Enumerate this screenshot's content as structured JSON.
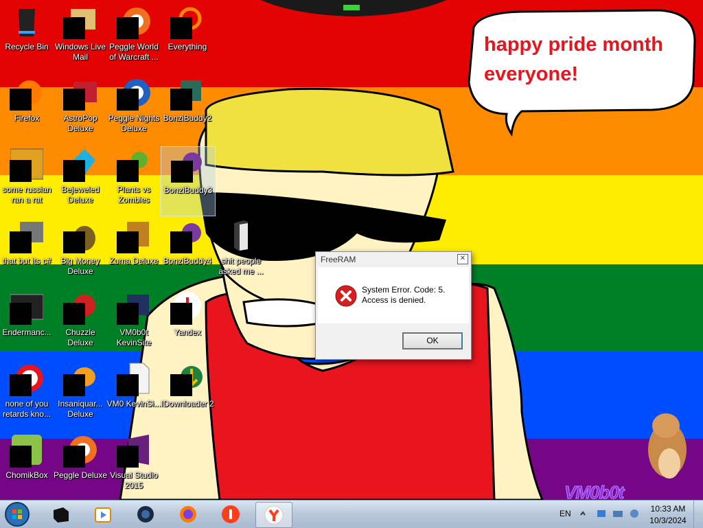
{
  "wallpaper": {
    "speech_bubble_text": "happy pride month everyone!",
    "watermark": "VM0b0t",
    "stripe_colors": [
      "#e40303",
      "#ff8c00",
      "#ffed00",
      "#008026",
      "#004dff",
      "#750787"
    ]
  },
  "desktop_icons": [
    {
      "label": "Recycle Bin",
      "icon": "recycle-bin-icon"
    },
    {
      "label": "Windows Live Mail",
      "icon": "windows-live-mail-icon"
    },
    {
      "label": "Peggle World of Warcraft ...",
      "icon": "peggle-wow-icon"
    },
    {
      "label": "Everything",
      "icon": "everything-search-icon"
    },
    {
      "label": "Firefox",
      "icon": "firefox-icon"
    },
    {
      "label": "AstroPop Deluxe",
      "icon": "astropop-icon"
    },
    {
      "label": "Peggle Nights Deluxe",
      "icon": "peggle-nights-icon"
    },
    {
      "label": "BonziBuddy2",
      "icon": "bonzibuddy-icon"
    },
    {
      "label": "some russian ran a rat",
      "icon": "russian-rat-icon"
    },
    {
      "label": "Bejeweled Deluxe",
      "icon": "bejeweled-icon"
    },
    {
      "label": "Plants vs Zombies",
      "icon": "pvz-icon"
    },
    {
      "label": "BonziBuddy3",
      "icon": "bonzibuddy-icon"
    },
    {
      "label": "that but its c#",
      "icon": "program-icon"
    },
    {
      "label": "Big Money Deluxe",
      "icon": "big-money-icon"
    },
    {
      "label": "Zuma Deluxe",
      "icon": "zuma-icon"
    },
    {
      "label": "BonziBuddy4",
      "icon": "bonzibuddy-icon"
    },
    {
      "label": "shit people asked me ...",
      "icon": "folder-icon"
    },
    {
      "label": "Endermanc...",
      "icon": "console-icon"
    },
    {
      "label": "Chuzzle Deluxe",
      "icon": "chuzzle-icon"
    },
    {
      "label": "VM0b0t KevinSite",
      "icon": "website-icon"
    },
    {
      "label": "Yandex",
      "icon": "yandex-icon"
    },
    {
      "label": "none of you retards kno...",
      "icon": "opera-icon"
    },
    {
      "label": "Insaniquar... Deluxe",
      "icon": "insaniquarium-icon"
    },
    {
      "label": "VM0 KevinSi...",
      "icon": "document-icon"
    },
    {
      "label": "IDownloader 2",
      "icon": "downloader-icon"
    },
    {
      "label": "ChomikBox",
      "icon": "chomikbox-icon"
    },
    {
      "label": "Peggle Deluxe",
      "icon": "peggle-icon"
    },
    {
      "label": "Visual Studio 2015",
      "icon": "visual-studio-icon"
    }
  ],
  "dialog": {
    "title": "FreeRAM",
    "message_line1": "System Error.  Code: 5.",
    "message_line2": "Access is denied.",
    "ok_label": "OK",
    "close_glyph": "✕"
  },
  "taskbar": {
    "pinned": [
      {
        "name": "taskbar-app-black-box",
        "icon": "black-box-icon"
      },
      {
        "name": "taskbar-windows-media-player",
        "icon": "media-player-icon"
      },
      {
        "name": "taskbar-dark-globe",
        "icon": "globe-icon"
      },
      {
        "name": "taskbar-firefox",
        "icon": "firefox-icon"
      },
      {
        "name": "taskbar-yandex-music",
        "icon": "yandex-red-icon"
      },
      {
        "name": "taskbar-yandex-browser",
        "icon": "yandex-browser-icon"
      }
    ],
    "language": "EN",
    "time": "10:33 AM",
    "date": "10/3/2024"
  },
  "colors": {
    "taskbar_top": "#dbe6f3",
    "taskbar_bottom": "#a9bbd1",
    "error_red": "#d62020",
    "bubble_text": "#e8141e"
  }
}
